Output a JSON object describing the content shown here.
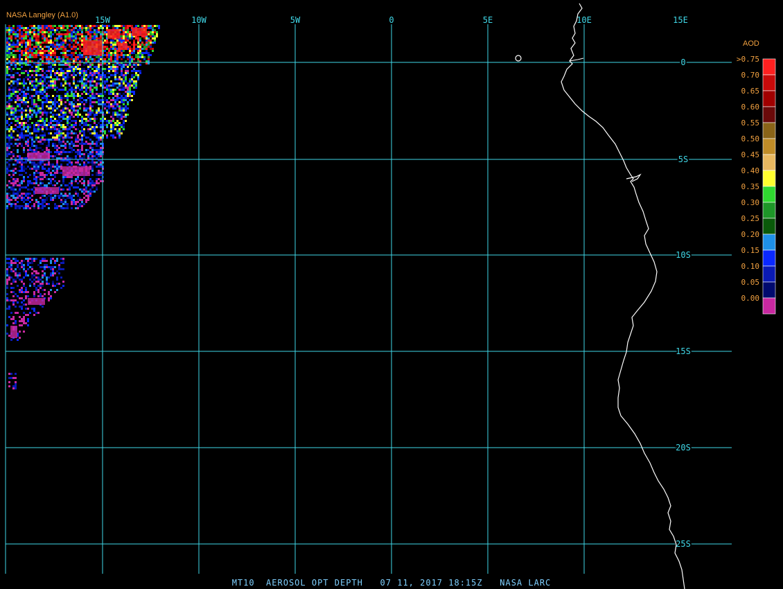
{
  "header": {
    "source": "NASA Langley (A1.0)"
  },
  "footer": {
    "caption": "MT10  AEROSOL OPT DEPTH   07 11, 2017 18:15Z   NASA LARC"
  },
  "grid": {
    "longitude_labels": [
      "15W",
      "10W",
      "5W",
      "0",
      "5E",
      "10E",
      "15E"
    ],
    "latitude_labels": [
      "0",
      "5S",
      "10S",
      "15S",
      "20S",
      "25S"
    ],
    "line_color": "#40d8e8",
    "label_color": "#40d8e8"
  },
  "coast_color": "#ffffff",
  "legend": {
    "title": "AOD",
    "labels": [
      ">0.75",
      "0.70",
      "0.65",
      "0.60",
      "0.55",
      "0.50",
      "0.45",
      "0.40",
      "0.35",
      "0.30",
      "0.25",
      "0.20",
      "0.15",
      "0.10",
      "0.05",
      "0.00"
    ],
    "colors": [
      "#ff2020",
      "#c80a0a",
      "#a00000",
      "#6a0a0a",
      "#8a6418",
      "#c08c28",
      "#e8b860",
      "#ffff30",
      "#30d830",
      "#1e9628",
      "#0a5a0a",
      "#1e90e8",
      "#0a28ff",
      "#0a1ab4",
      "#000a6e",
      "#c828a0"
    ],
    "label_color": "#f0a040"
  }
}
